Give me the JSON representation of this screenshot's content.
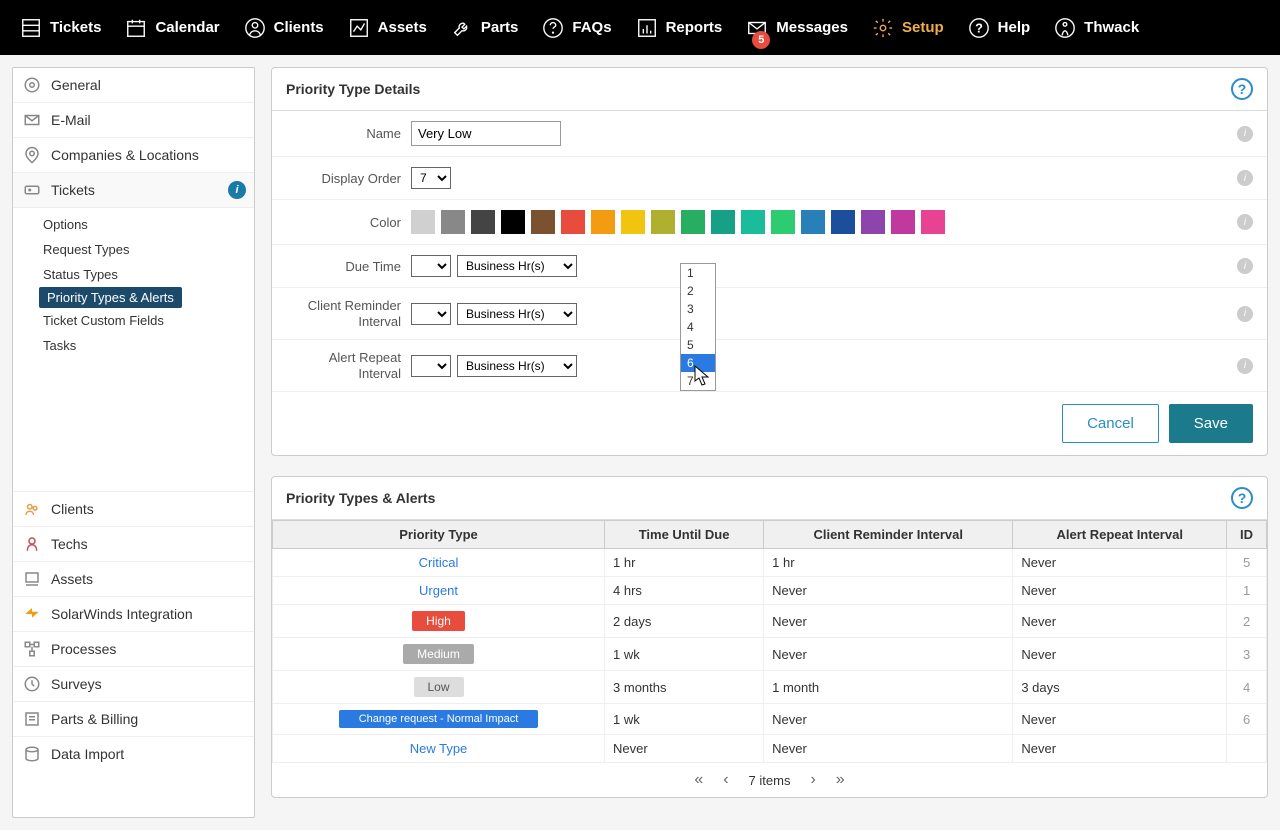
{
  "nav": {
    "items": [
      {
        "label": "Tickets"
      },
      {
        "label": "Calendar"
      },
      {
        "label": "Clients"
      },
      {
        "label": "Assets"
      },
      {
        "label": "Parts"
      },
      {
        "label": "FAQs"
      },
      {
        "label": "Reports"
      },
      {
        "label": "Messages",
        "badge": "5"
      },
      {
        "label": "Setup",
        "active": true
      },
      {
        "label": "Help"
      },
      {
        "label": "Thwack"
      }
    ]
  },
  "sidebar": {
    "groups": [
      {
        "label": "General"
      },
      {
        "label": "E-Mail"
      },
      {
        "label": "Companies & Locations"
      },
      {
        "label": "Tickets",
        "expanded": true,
        "subitems": [
          {
            "label": "Options"
          },
          {
            "label": "Request Types"
          },
          {
            "label": "Status Types"
          },
          {
            "label": "Priority Types & Alerts",
            "active": true
          },
          {
            "label": "Ticket Custom Fields"
          },
          {
            "label": "Tasks"
          }
        ]
      },
      {
        "label": "Clients"
      },
      {
        "label": "Techs"
      },
      {
        "label": "Assets"
      },
      {
        "label": "SolarWinds Integration"
      },
      {
        "label": "Processes"
      },
      {
        "label": "Surveys"
      },
      {
        "label": "Parts & Billing"
      },
      {
        "label": "Data Import"
      }
    ]
  },
  "detail": {
    "title": "Priority Type Details",
    "name_label": "Name",
    "name_value": "Very Low",
    "order_label": "Display Order",
    "order_value": "7",
    "order_options": [
      "1",
      "2",
      "3",
      "4",
      "5",
      "6",
      "7"
    ],
    "color_label": "Color",
    "colors": [
      "#d0d0d0",
      "#888888",
      "#444444",
      "#000000",
      "#7a5230",
      "#e74c3c",
      "#f39c12",
      "#f1c40f",
      "#b0b030",
      "#27ae60",
      "#16a085",
      "#1abc9c",
      "#2ecc71",
      "#2980b9",
      "#1b4f9c",
      "#8e44ad",
      "#c0399f",
      "#e84393"
    ],
    "due_label": "Due Time",
    "unit": "Business Hr(s)",
    "reminder_label1": "Client Reminder",
    "reminder_label2": "Interval",
    "alert_label1": "Alert Repeat",
    "alert_label2": "Interval",
    "cancel": "Cancel",
    "save": "Save"
  },
  "list": {
    "title": "Priority Types & Alerts",
    "headers": [
      "Priority Type",
      "Time Until Due",
      "Client Reminder Interval",
      "Alert Repeat Interval",
      "ID"
    ],
    "rows": [
      {
        "name": "Critical",
        "style": "link",
        "due": "1 hr",
        "reminder": "1 hr",
        "alert": "Never",
        "id": "5"
      },
      {
        "name": "Urgent",
        "style": "link",
        "due": "4 hrs",
        "reminder": "Never",
        "alert": "Never",
        "id": "1"
      },
      {
        "name": "High",
        "style": "pill-high",
        "due": "2 days",
        "reminder": "Never",
        "alert": "Never",
        "id": "2"
      },
      {
        "name": "Medium",
        "style": "pill-med",
        "due": "1 wk",
        "reminder": "Never",
        "alert": "Never",
        "id": "3"
      },
      {
        "name": "Low",
        "style": "pill-low",
        "due": "3 months",
        "reminder": "1 month",
        "alert": "3 days",
        "id": "4"
      },
      {
        "name": "Change request - Normal Impact",
        "style": "pill-change",
        "due": "1 wk",
        "reminder": "Never",
        "alert": "Never",
        "id": "6"
      },
      {
        "name": "New Type",
        "style": "link",
        "due": "Never",
        "reminder": "Never",
        "alert": "Never",
        "id": ""
      }
    ],
    "pager": "7 items"
  }
}
